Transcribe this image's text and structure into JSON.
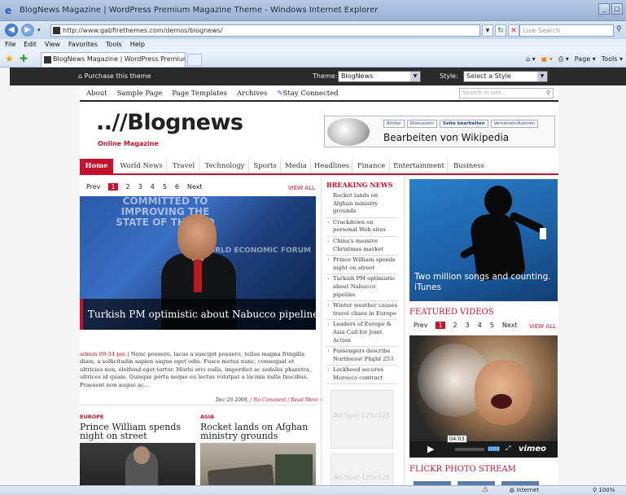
{
  "browser": {
    "title": "BlogNews Magazine | WordPress Premium Magazine Theme - Windows Internet Explorer",
    "address": "http://www.gabfirethemes.com/demos/blognews/",
    "search_placeholder": "Live Search",
    "menu": [
      "File",
      "Edit",
      "View",
      "Favorites",
      "Tools",
      "Help"
    ],
    "tab_title": "BlogNews Magazine | WordPress Premium Magazine T...",
    "commands": [
      "Page ▾",
      "Tools ▾"
    ],
    "status_zone": "Internet",
    "zoom": "100%"
  },
  "theme_bar": {
    "purchase": "Purchase this theme",
    "theme_label": "Theme:",
    "theme_value": "BlogNews",
    "style_label": "Style:",
    "style_value": "Select a Style"
  },
  "top_nav": {
    "items": [
      "About",
      "Sample Page",
      "Page Templates",
      "Archives",
      "Stay Connected"
    ],
    "search_placeholder": "Search in site..."
  },
  "site": {
    "logo": "..//Blognews",
    "tagline": "Online Magazine"
  },
  "wiki_banner": {
    "tabs": [
      "Artikel",
      "Diskussion",
      "Seite bearbeiten",
      "Versionen/Autoren"
    ],
    "text": "Bearbeiten von Wikipedia"
  },
  "categories": [
    "Home",
    "World News",
    "Travel",
    "Technology",
    "Sports",
    "Media",
    "Headlines",
    "Finance",
    "Entertainment",
    "Business"
  ],
  "pager": {
    "prev": "Prev",
    "pages": [
      "1",
      "2",
      "3",
      "4",
      "5",
      "6"
    ],
    "next": "Next",
    "view_all": "VIEW ALL"
  },
  "featured": {
    "banner_text": "COMMITTED TO IMPROVING THE STATE OF THE WO",
    "logo_text": "WORLD ECONOMIC FORUM",
    "caption": "Turkish PM optimistic about Nabucco pipeline",
    "meta": "admin 09:34 pm",
    "excerpt": " | Nunc posuere, lacus a suscipit posuere, tellus magna fringilla diam, a sollicitudin sapien augue eget odio. Fusce metus nunc, consequat et ultricies non, eleifend eget tortor. Morbi orci nulla, imperdiet ac sodales pharetra, ultrices id quam. Quisque porta neque eu lectus volutpat a lacinia nulla faucibus. Praesent non augue ac...",
    "date": "Dec 26 2009, ",
    "comments": "/ No Comment / Read More »"
  },
  "sub_posts": [
    {
      "category": "EUROPE",
      "title": "Prince William spends night on street"
    },
    {
      "category": "ASIA",
      "title": "Rocket lands on Afghan ministry grounds"
    }
  ],
  "breaking": {
    "title": "BREAKING NEWS",
    "items": [
      "Rocket lands on Afghan ministry grounds",
      "Crackdown on personal Web sites",
      "China's massive Christmas market",
      "Prince William spends night on street",
      "Turkish PM optimistic about Nabucco pipeline",
      "Winter weather causes travel chaos in Europe",
      "Leaders of Europe & Asia Call for Joint Action",
      "Passengers describe Northwest Flight 253",
      "Lockheed secures Morocco contract"
    ]
  },
  "ads": [
    "Ad Spot 125x125",
    "Ad Spot 125x125"
  ],
  "itunes": {
    "line1": "Two million songs and counting.",
    "line2": "iTunes"
  },
  "videos": {
    "title": "FEATURED VIDEOS",
    "pages": [
      "1",
      "2",
      "3",
      "4",
      "5"
    ],
    "time": "04:03",
    "brand": "vimeo"
  },
  "flickr": {
    "title": "FLICKR PHOTO STREAM"
  }
}
